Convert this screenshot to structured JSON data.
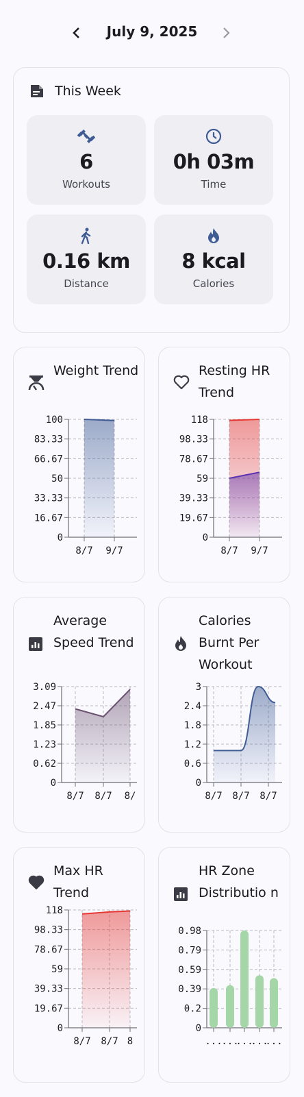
{
  "header": {
    "date": "July 9, 2025",
    "prev_icon": "chevron-left-icon",
    "next_icon": "chevron-right-icon"
  },
  "this_week": {
    "title": "This Week",
    "icon": "note-icon",
    "stats": [
      {
        "value": "6",
        "label": "Workouts",
        "icon": "dumbbell-icon"
      },
      {
        "value": "0h 03m",
        "label": "Time",
        "icon": "clock-icon"
      },
      {
        "value": "0.16 km",
        "label": "Distance",
        "icon": "walking-icon"
      },
      {
        "value": "8 kcal",
        "label": "Calories",
        "icon": "flame-icon"
      }
    ]
  },
  "colors": {
    "accent": "#3f5c94",
    "icon": "#3b3b46",
    "red": "#e53935",
    "purple": "#5e35b1",
    "mauve": "#6b5170",
    "green": "#a5d6a7"
  },
  "chart_data": [
    {
      "title": "Weight Trend",
      "icon": "scale-icon",
      "type": "area",
      "x_labels": [
        "8/7",
        "9/7"
      ],
      "y_ticks": [
        "100",
        "83.33",
        "66.67",
        "50",
        "33.33",
        "16.67",
        "0"
      ],
      "ylim": [
        0,
        100
      ],
      "series": [
        {
          "values": [
            100,
            99
          ]
        }
      ]
    },
    {
      "title": "Resting HR Trend",
      "icon": "heart-outline-icon",
      "type": "area",
      "x_labels": [
        "8/7",
        "9/7"
      ],
      "y_ticks": [
        "118",
        "98.33",
        "78.67",
        "59",
        "39.33",
        "19.67",
        "0"
      ],
      "ylim": [
        0,
        118
      ],
      "series": [
        {
          "values": [
            117,
            118
          ]
        },
        {
          "values": [
            59,
            65
          ]
        }
      ]
    },
    {
      "title": "Average Speed Trend",
      "icon": "chart-icon",
      "type": "area",
      "x_labels": [
        "8/7",
        "8/7",
        "8/"
      ],
      "y_ticks": [
        "3.09",
        "2.47",
        "1.85",
        "1.23",
        "0.62",
        "0"
      ],
      "ylim": [
        0,
        3.09
      ],
      "series": [
        {
          "values": [
            2.37,
            2.12,
            3.0
          ]
        }
      ]
    },
    {
      "title": "Calories Burnt Per Workout",
      "icon": "flame-icon",
      "type": "area",
      "x_labels": [
        "8/7",
        "8/7",
        "8/7"
      ],
      "y_ticks": [
        "3",
        "2.4",
        "1.8",
        "1.2",
        "0.6",
        "0"
      ],
      "ylim": [
        0,
        3
      ],
      "series": [
        {
          "values": [
            1,
            1,
            3,
            2.5
          ]
        }
      ]
    },
    {
      "title": "Max HR Trend",
      "icon": "heart-icon",
      "type": "area",
      "x_labels": [
        "8/7",
        "8/7",
        "8"
      ],
      "y_ticks": [
        "118",
        "98.33",
        "78.67",
        "59",
        "39.33",
        "19.67",
        "0"
      ],
      "ylim": [
        0,
        118
      ],
      "series": [
        {
          "values": [
            114,
            116,
            117
          ]
        }
      ]
    },
    {
      "title": "HR Zone Distributio n",
      "icon": "chart-icon",
      "type": "bar",
      "x_labels": [
        "...",
        "...",
        "...",
        "...",
        "..."
      ],
      "y_ticks": [
        "0.98",
        "0.79",
        "0.59",
        "0.39",
        "0.2",
        "0"
      ],
      "ylim": [
        0,
        0.98
      ],
      "series": [
        {
          "values": [
            0.4,
            0.43,
            0.98,
            0.53,
            0.5
          ]
        }
      ]
    }
  ]
}
